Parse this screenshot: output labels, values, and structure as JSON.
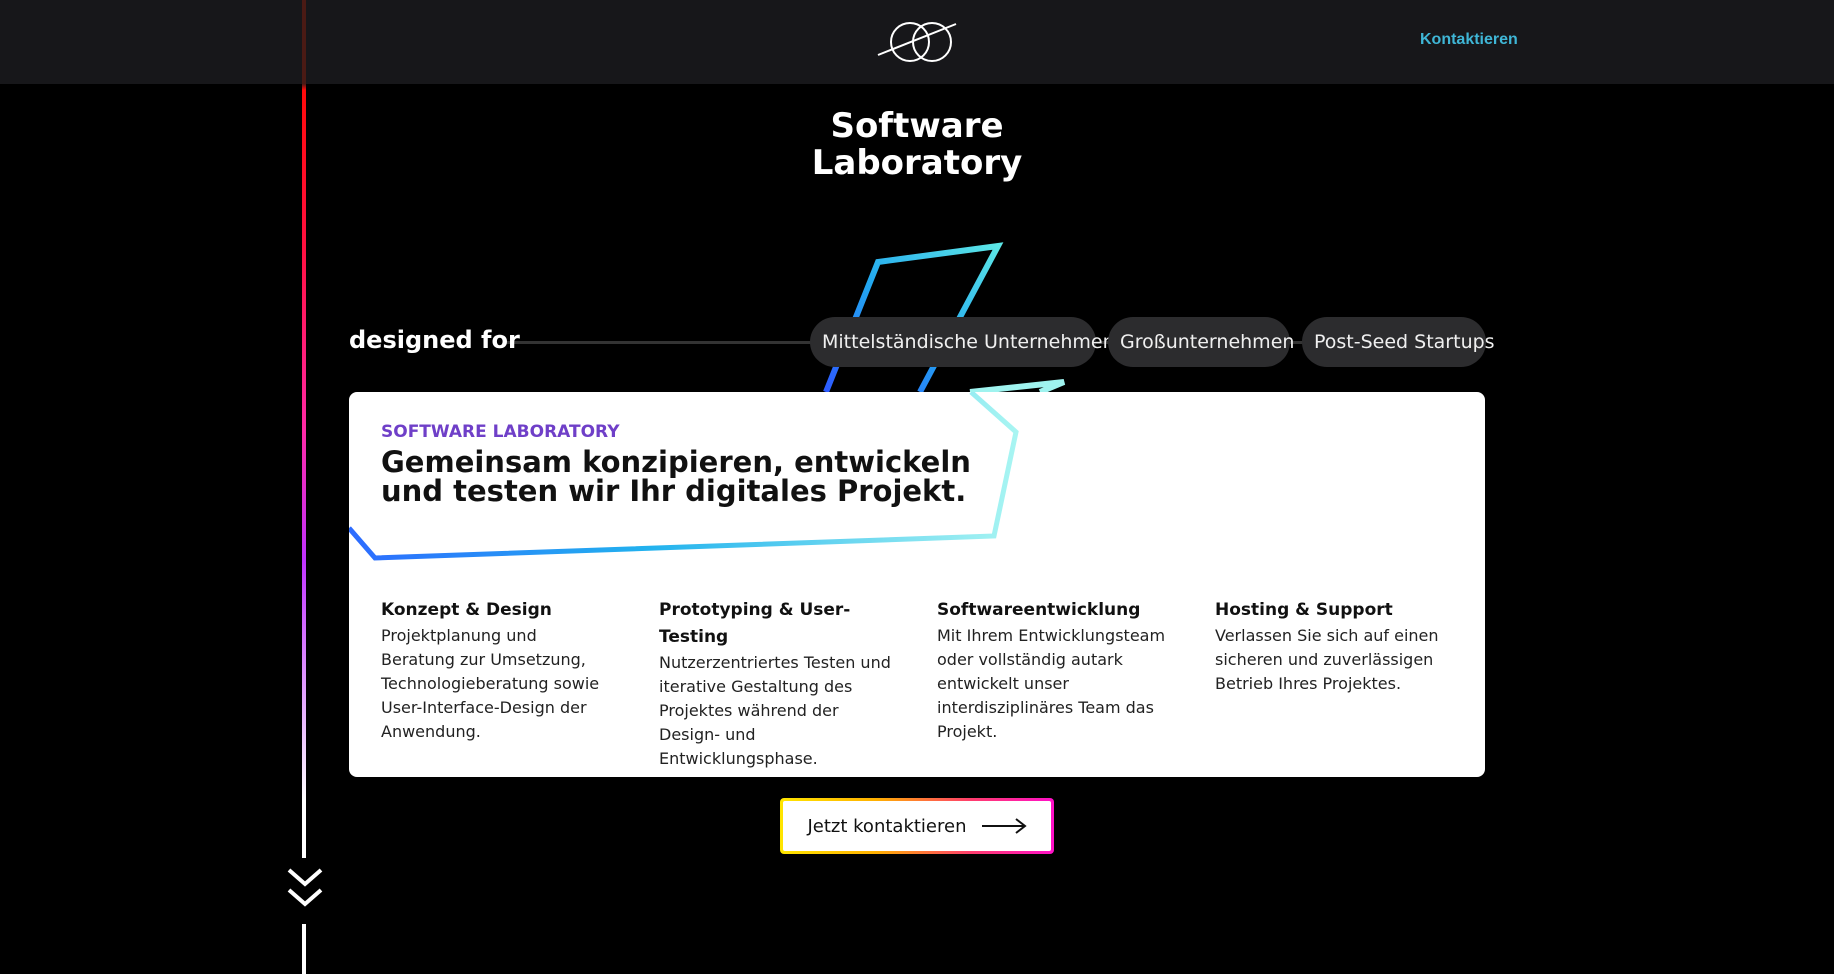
{
  "header": {
    "logo_icon": "orbit-logo-icon",
    "nav_contact_label": "Kontaktieren"
  },
  "hero": {
    "title_line1": "Software",
    "title_line2": "Laboratory"
  },
  "audience": {
    "label": "designed for",
    "tags": [
      "Mittelständische Unternehmen",
      "Großunternehmen",
      "Post-Seed Startups"
    ]
  },
  "card": {
    "eyebrow": "SOFTWARE LABORATORY",
    "heading_line1": "Gemeinsam konzipieren, entwickeln",
    "heading_line2": "und testen wir Ihr digitales Projekt.",
    "features": [
      {
        "title": "Konzept & Design",
        "text": "Projektplanung und Beratung zur Umsetzung, Technologieberatung sowie User-Interface-Design der Anwendung."
      },
      {
        "title": "Prototyping & User-Testing",
        "text": "Nutzerzentriertes Testen und iterative Gestaltung des Projektes während der Design- und Entwicklungsphase."
      },
      {
        "title": "Softwareentwicklung",
        "text": "Mit Ihrem Entwicklungsteam oder vollständig autark entwickelt unser interdisziplinäres Team das Projekt."
      },
      {
        "title": "Hosting & Support",
        "text": "Verlassen Sie sich auf einen sicheren und zuverlässigen Betrieb Ihres Projektes."
      }
    ]
  },
  "cta": {
    "label": "Jetzt kontaktieren",
    "icon": "arrow-right-icon"
  },
  "scroll": {
    "icon": "chevron-double-down-icon"
  },
  "colors": {
    "background": "#000000",
    "topbar": "#17171a",
    "accent_cyan": "#3fb6d6",
    "eyebrow_purple": "#6f3fc8",
    "tag_background": "#2c2c2e"
  }
}
